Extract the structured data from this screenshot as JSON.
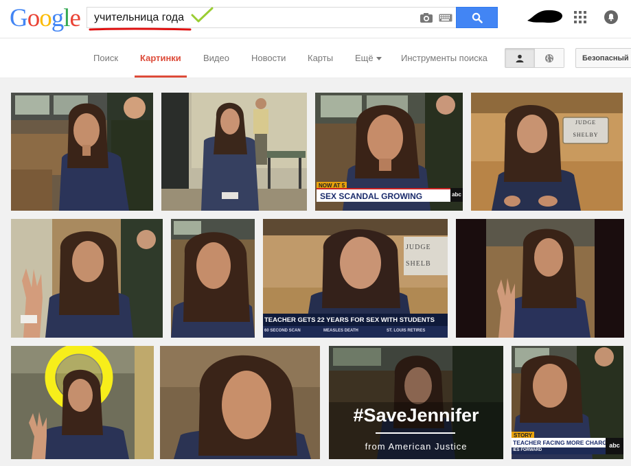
{
  "header": {
    "logo_text": "Google",
    "search_query": "учительница года",
    "colors": {
      "blue": "#4285f4",
      "red": "#ea4335",
      "yellow": "#fbbc05",
      "green": "#34a853",
      "annotation_red": "#e01010",
      "annotation_check": "#9acd32"
    },
    "icons": [
      "camera-icon",
      "keyboard-icon",
      "search-icon",
      "apps-icon",
      "notification-icon"
    ]
  },
  "nav": {
    "tabs": [
      {
        "label": "Поиск",
        "active": false
      },
      {
        "label": "Картинки",
        "active": true
      },
      {
        "label": "Видео",
        "active": false
      },
      {
        "label": "Новости",
        "active": false
      },
      {
        "label": "Карты",
        "active": false
      },
      {
        "label": "Ещё",
        "active": false
      },
      {
        "label": "Инструменты поиска",
        "active": false
      }
    ],
    "toggle_icons": [
      "person-icon",
      "globe-icon"
    ],
    "safe_search_label": "Безопасный"
  },
  "results": {
    "images": [
      {
        "row": 1,
        "caption": ""
      },
      {
        "row": 1,
        "caption": ""
      },
      {
        "row": 1,
        "caption": "SEX SCANDAL GROWING",
        "tag": "NOW AT 5",
        "logo": "abc"
      },
      {
        "row": 1,
        "caption": "",
        "sign_lines": [
          "JUDGE",
          "SHELBY"
        ]
      },
      {
        "row": 2,
        "caption": ""
      },
      {
        "row": 2,
        "caption": ""
      },
      {
        "row": 2,
        "caption": "TEACHER GETS 22 YEARS FOR SEX WITH STUDENTS",
        "ticker": [
          "60 SECOND SCAN",
          "MEASLES DEATH",
          "ST. LOUIS RETIRES"
        ],
        "sign_lines": [
          "JUDGE",
          "SHELB"
        ]
      },
      {
        "row": 2,
        "caption": ""
      },
      {
        "row": 3,
        "caption": ""
      },
      {
        "row": 3,
        "caption": ""
      },
      {
        "row": 3,
        "caption": "#SaveJennifer",
        "subcaption": "from American Justice"
      },
      {
        "row": 3,
        "caption": "TEACHER FACING MORE CHARGES",
        "tag": "STORY",
        "ticker": [
          "IES FORWARD"
        ],
        "logo": "abc"
      }
    ]
  }
}
